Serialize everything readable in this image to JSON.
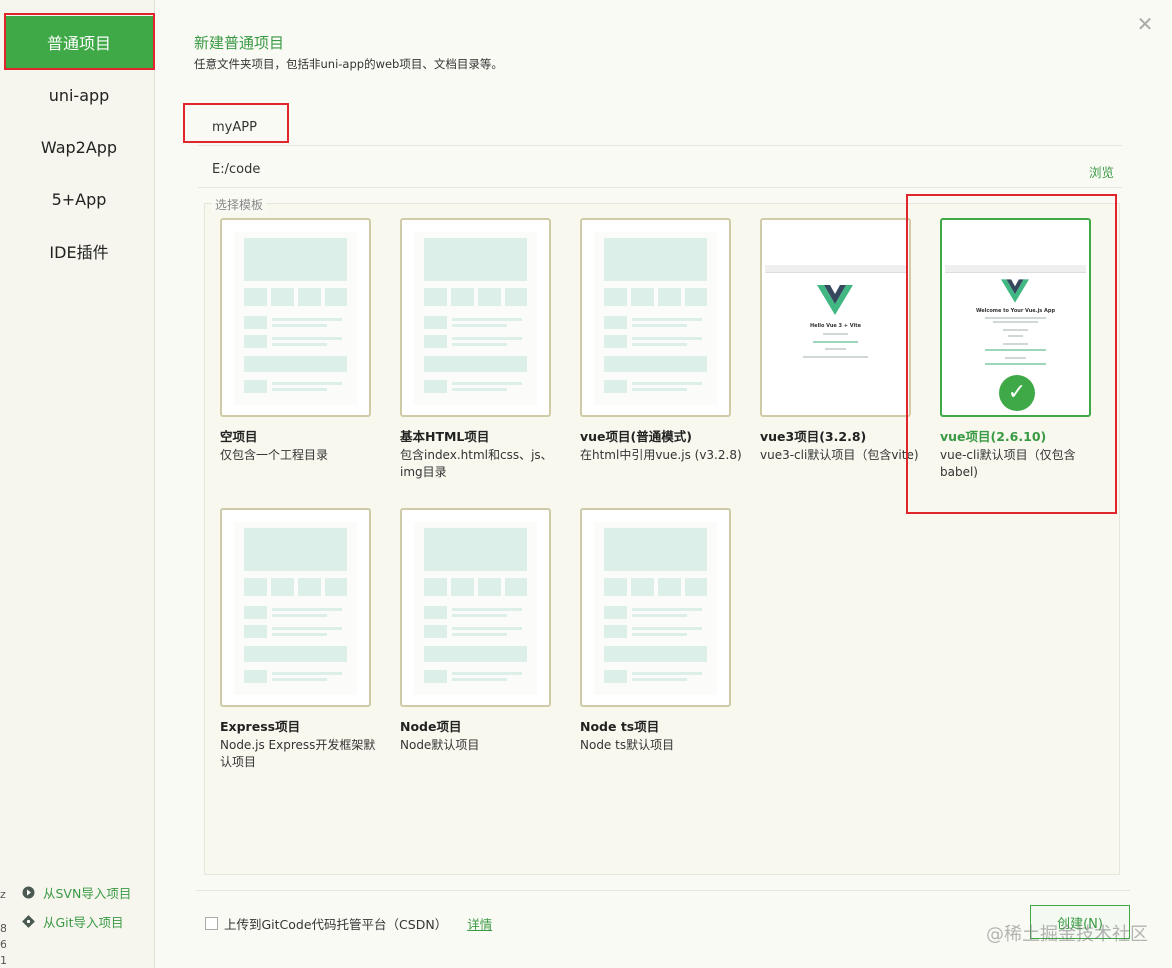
{
  "sidebar": {
    "items": [
      {
        "label": "普通项目",
        "active": true
      },
      {
        "label": "uni-app"
      },
      {
        "label": "Wap2App"
      },
      {
        "label": "5+App"
      },
      {
        "label": "IDE插件"
      }
    ],
    "import_svn": "从SVN导入项目",
    "import_git": "从Git导入项目"
  },
  "header": {
    "title": "新建普通项目",
    "subtitle": "任意文件夹项目，包括非uni-app的web项目、文档目录等。"
  },
  "form": {
    "project_name": "myAPP",
    "location": "E:/code",
    "browse_label": "浏览"
  },
  "templates": {
    "legend": "选择模板",
    "items": [
      {
        "name": "空项目",
        "desc": "仅包含一个工程目录"
      },
      {
        "name": "基本HTML项目",
        "desc": "包含index.html和css、js、img目录"
      },
      {
        "name": "vue项目(普通模式)",
        "desc": "在html中引用vue.js (v3.2.8)"
      },
      {
        "name": "vue3项目(3.2.8)",
        "desc": "vue3-cli默认项目（包含vite)",
        "preview_title": "Hello Vue 3 + Vite"
      },
      {
        "name": "vue项目(2.6.10)",
        "desc": "vue-cli默认项目（仅包含babel)",
        "selected": true,
        "preview_title": "Welcome to Your Vue.js App"
      },
      {
        "name": "Express项目",
        "desc": "Node.js Express开发框架默认项目"
      },
      {
        "name": "Node项目",
        "desc": "Node默认项目"
      },
      {
        "name": "Node ts项目",
        "desc": "Node ts默认项目"
      }
    ]
  },
  "footer": {
    "upload_label": "上传到GitCode代码托管平台（CSDN）",
    "upload_checked": false,
    "detail_link": "详情",
    "create_button": "创建(N)"
  },
  "watermark": "@稀土掘金技术社区",
  "colors": {
    "accent": "#3fa947",
    "highlight_box": "#e0262a",
    "thumb_border": "#cfcba6",
    "wireframe": "#dcefe9"
  }
}
